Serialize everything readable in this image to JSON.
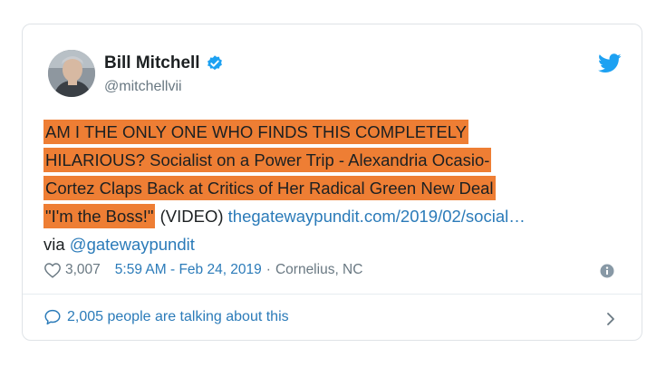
{
  "tweet": {
    "author_name": "Bill Mitchell",
    "author_handle": "@mitchellvii",
    "text_line1": "AM I THE ONLY ONE WHO FINDS THIS COMPLETELY",
    "text_line2": "HILARIOUS? Socialist on a Power Trip - Alexandria Ocasio-",
    "text_line3": "Cortez Claps Back at Critics of Her Radical Green New Deal",
    "text_line4_hl": "\"I'm the Boss!\"",
    "text_line4_rest": " (VIDEO) ",
    "link": "thegatewaypundit.com/2019/02/social…",
    "via_prefix": "via ",
    "via_handle": "@gatewaypundit",
    "likes": "3,007",
    "timestamp": "5:59 AM - Feb 24, 2019",
    "separator": "·",
    "location": "Cornelius, NC",
    "talking": "2,005 people are talking about this"
  },
  "icons": {
    "verified": "verified-badge-icon",
    "bird": "twitter-bird-icon",
    "heart": "heart-icon",
    "info": "info-icon",
    "bubble": "speech-bubble-icon",
    "chevron": "chevron-right-icon"
  },
  "colors": {
    "highlight": "#ee7e34",
    "link": "#2b7bb9",
    "muted": "#697882",
    "twitter_blue": "#1da1f2"
  }
}
